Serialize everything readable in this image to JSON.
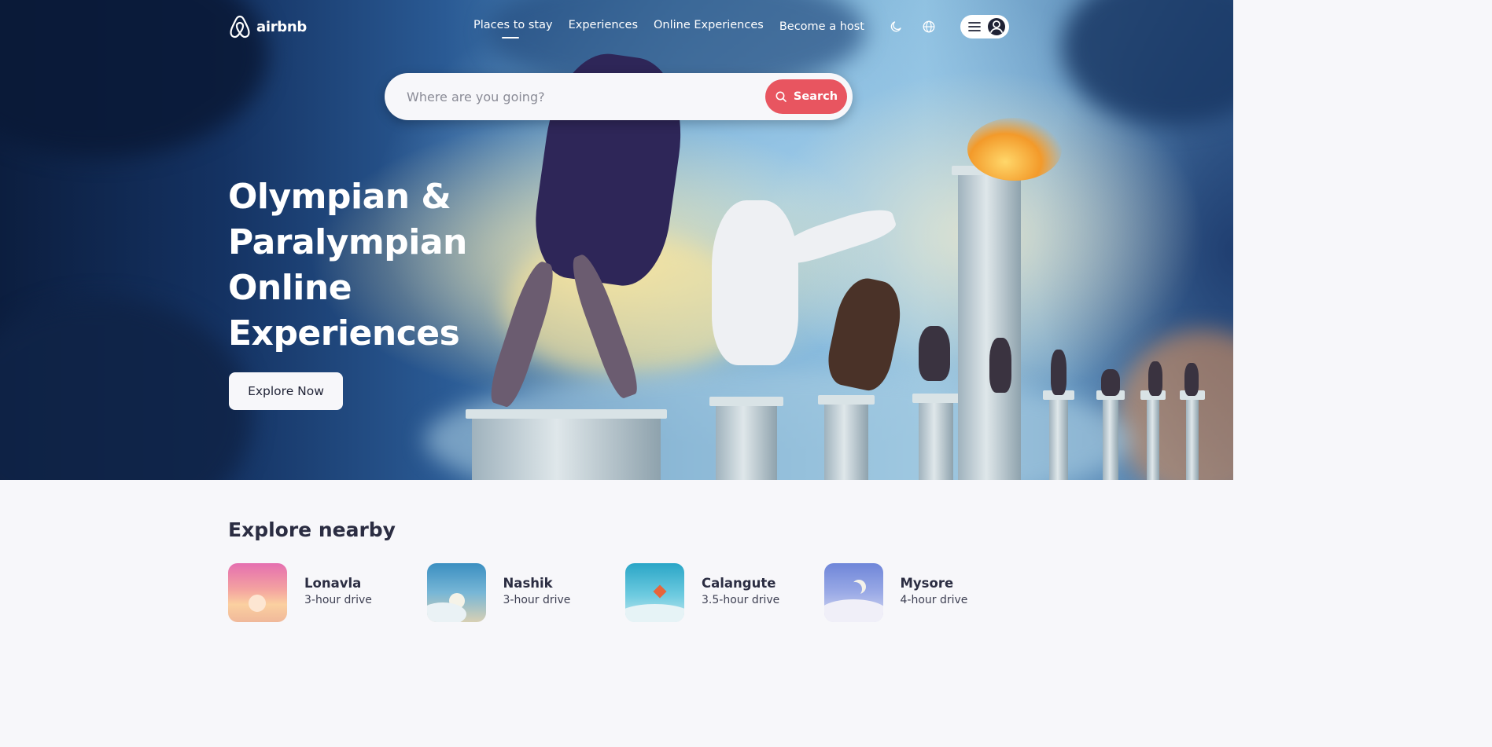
{
  "nav": {
    "logo_text": "airbnb",
    "links": [
      {
        "label": "Places to stay",
        "active": true
      },
      {
        "label": "Experiences",
        "active": false
      },
      {
        "label": "Online Experiences",
        "active": false
      }
    ],
    "become_host": "Become a host",
    "icons": [
      "moon-icon",
      "globe-icon",
      "hamburger-icon",
      "user-icon"
    ]
  },
  "search": {
    "placeholder": "Where are you going?",
    "button_label": "Search",
    "button_color": "#e85560"
  },
  "hero": {
    "headline_lines": [
      "Olympian &",
      "Paralympian",
      "Online",
      "Experiences"
    ],
    "cta_label": "Explore Now"
  },
  "nearby": {
    "title": "Explore nearby",
    "places": [
      {
        "name": "Lonavla",
        "drive": "3-hour drive"
      },
      {
        "name": "Nashik",
        "drive": "3-hour drive"
      },
      {
        "name": "Calangute",
        "drive": "3.5-hour drive"
      },
      {
        "name": "Mysore",
        "drive": "4-hour drive"
      }
    ]
  }
}
